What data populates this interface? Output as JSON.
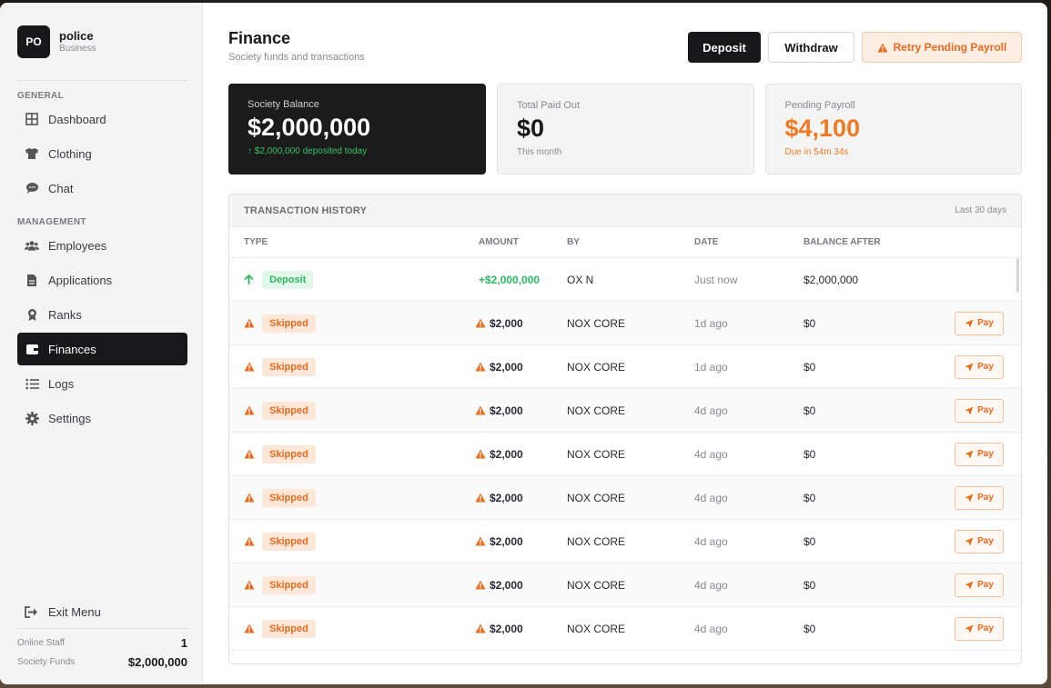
{
  "brand": {
    "badge": "PO",
    "name": "police",
    "subtitle": "Business"
  },
  "sidebar": {
    "general_label": "GENERAL",
    "management_label": "MANAGEMENT",
    "general_items": [
      {
        "label": "Dashboard",
        "icon": "dashboard-icon"
      },
      {
        "label": "Clothing",
        "icon": "shirt-icon"
      },
      {
        "label": "Chat",
        "icon": "chat-icon"
      }
    ],
    "management_items": [
      {
        "label": "Employees",
        "icon": "users-icon"
      },
      {
        "label": "Applications",
        "icon": "file-icon"
      },
      {
        "label": "Ranks",
        "icon": "award-icon"
      },
      {
        "label": "Finances",
        "icon": "wallet-icon",
        "active": true
      },
      {
        "label": "Logs",
        "icon": "list-icon"
      },
      {
        "label": "Settings",
        "icon": "gear-icon"
      }
    ],
    "exit_label": "Exit Menu",
    "online_staff_label": "Online Staff",
    "online_staff_value": "1",
    "society_funds_label": "Society Funds",
    "society_funds_value": "$2,000,000"
  },
  "header": {
    "title": "Finance",
    "subtitle": "Society funds and transactions",
    "deposit_label": "Deposit",
    "withdraw_label": "Withdraw",
    "retry_label": "Retry Pending Payroll"
  },
  "cards": {
    "balance": {
      "label": "Society Balance",
      "value": "$2,000,000",
      "note": "↑ $2,000,000 deposited today"
    },
    "paid_out": {
      "label": "Total Paid Out",
      "value": "$0",
      "note": "This month"
    },
    "pending": {
      "label": "Pending Payroll",
      "value": "$4,100",
      "note": "Due in 54m 34s"
    }
  },
  "table": {
    "title": "TRANSACTION HISTORY",
    "range": "Last 30 days",
    "columns": {
      "type": "TYPE",
      "amount": "AMOUNT",
      "by": "BY",
      "date": "DATE",
      "balance_after": "BALANCE AFTER"
    },
    "pay_label": "Pay",
    "rows": [
      {
        "type": "Deposit",
        "kind": "deposit",
        "amount": "+$2,000,000",
        "by": "OX N",
        "date": "Just now",
        "balance_after": "$2,000,000"
      },
      {
        "type": "Skipped",
        "kind": "skipped",
        "amount": "$2,000",
        "by": "NOX CORE",
        "date": "1d ago",
        "balance_after": "$0"
      },
      {
        "type": "Skipped",
        "kind": "skipped",
        "amount": "$2,000",
        "by": "NOX CORE",
        "date": "1d ago",
        "balance_after": "$0"
      },
      {
        "type": "Skipped",
        "kind": "skipped",
        "amount": "$2,000",
        "by": "NOX CORE",
        "date": "4d ago",
        "balance_after": "$0"
      },
      {
        "type": "Skipped",
        "kind": "skipped",
        "amount": "$2,000",
        "by": "NOX CORE",
        "date": "4d ago",
        "balance_after": "$0"
      },
      {
        "type": "Skipped",
        "kind": "skipped",
        "amount": "$2,000",
        "by": "NOX CORE",
        "date": "4d ago",
        "balance_after": "$0"
      },
      {
        "type": "Skipped",
        "kind": "skipped",
        "amount": "$2,000",
        "by": "NOX CORE",
        "date": "4d ago",
        "balance_after": "$0"
      },
      {
        "type": "Skipped",
        "kind": "skipped",
        "amount": "$2,000",
        "by": "NOX CORE",
        "date": "4d ago",
        "balance_after": "$0"
      },
      {
        "type": "Skipped",
        "kind": "skipped",
        "amount": "$2,000",
        "by": "NOX CORE",
        "date": "4d ago",
        "balance_after": "$0"
      }
    ]
  },
  "colors": {
    "accent_dark": "#18181b",
    "warning": "#ea6a1f",
    "success": "#2cb864"
  }
}
